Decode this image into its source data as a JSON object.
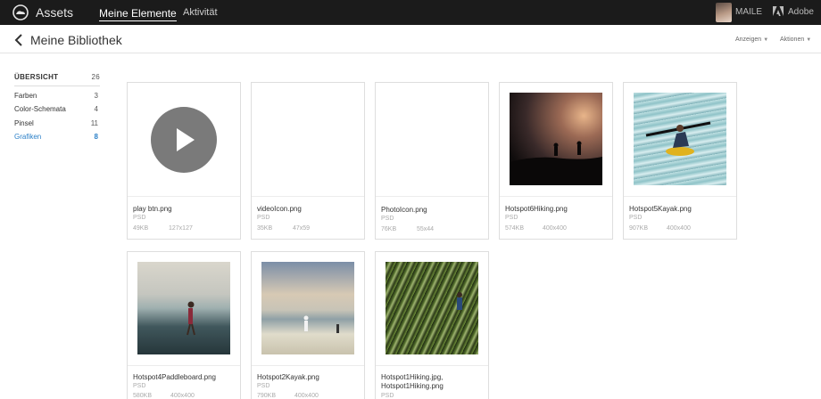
{
  "topbar": {
    "app_title": "Assets",
    "nav_mine": "Meine Elemente",
    "nav_activity": "Aktivität",
    "user_name": "MAILE",
    "adobe": "Adobe"
  },
  "header": {
    "page_title": "Meine Bibliothek",
    "view_menu": "Anzeigen",
    "actions_menu": "Aktionen"
  },
  "sidebar": {
    "heading": "ÜBERSICHT",
    "heading_count": "26",
    "items": [
      {
        "label": "Farben",
        "count": "3"
      },
      {
        "label": "Color-Schemata",
        "count": "4"
      },
      {
        "label": "Pinsel",
        "count": "11"
      },
      {
        "label": "Grafiken",
        "count": "8"
      }
    ]
  },
  "colors": {
    "topbar_bg": "#1b1b1b",
    "accent": "#2b80c8",
    "play_circle": "#7a7a7a"
  },
  "assets": [
    {
      "name": "play btn.png",
      "type": "PSD",
      "size": "49KB",
      "dims": "127x127",
      "thumb": "play-button-icon"
    },
    {
      "name": "videoIcon.png",
      "type": "PSD",
      "size": "35KB",
      "dims": "47x59",
      "thumb": "blank"
    },
    {
      "name": "PhotoIcon.png",
      "type": "PSD",
      "size": "76KB",
      "dims": "55x44",
      "thumb": "blank"
    },
    {
      "name": "Hotspot6Hiking.png",
      "type": "PSD",
      "size": "574KB",
      "dims": "400x400",
      "thumb": "hiking-silhouette-photo"
    },
    {
      "name": "Hotspot5Kayak.png",
      "type": "PSD",
      "size": "907KB",
      "dims": "400x400",
      "thumb": "kayak-photo"
    },
    {
      "name": "Hotspot4Paddleboard.png",
      "type": "PSD",
      "size": "580KB",
      "dims": "400x400",
      "thumb": "paddleboard-photo"
    },
    {
      "name": "Hotspot2Kayak.png",
      "type": "PSD",
      "size": "790KB",
      "dims": "400x400",
      "thumb": "beach-photo"
    },
    {
      "name": "Hotspot1Hiking.jpg, Hotspot1Hiking.png",
      "type": "PSD",
      "size": "",
      "dims": "",
      "thumb": "jungle-hiking-photo"
    }
  ]
}
